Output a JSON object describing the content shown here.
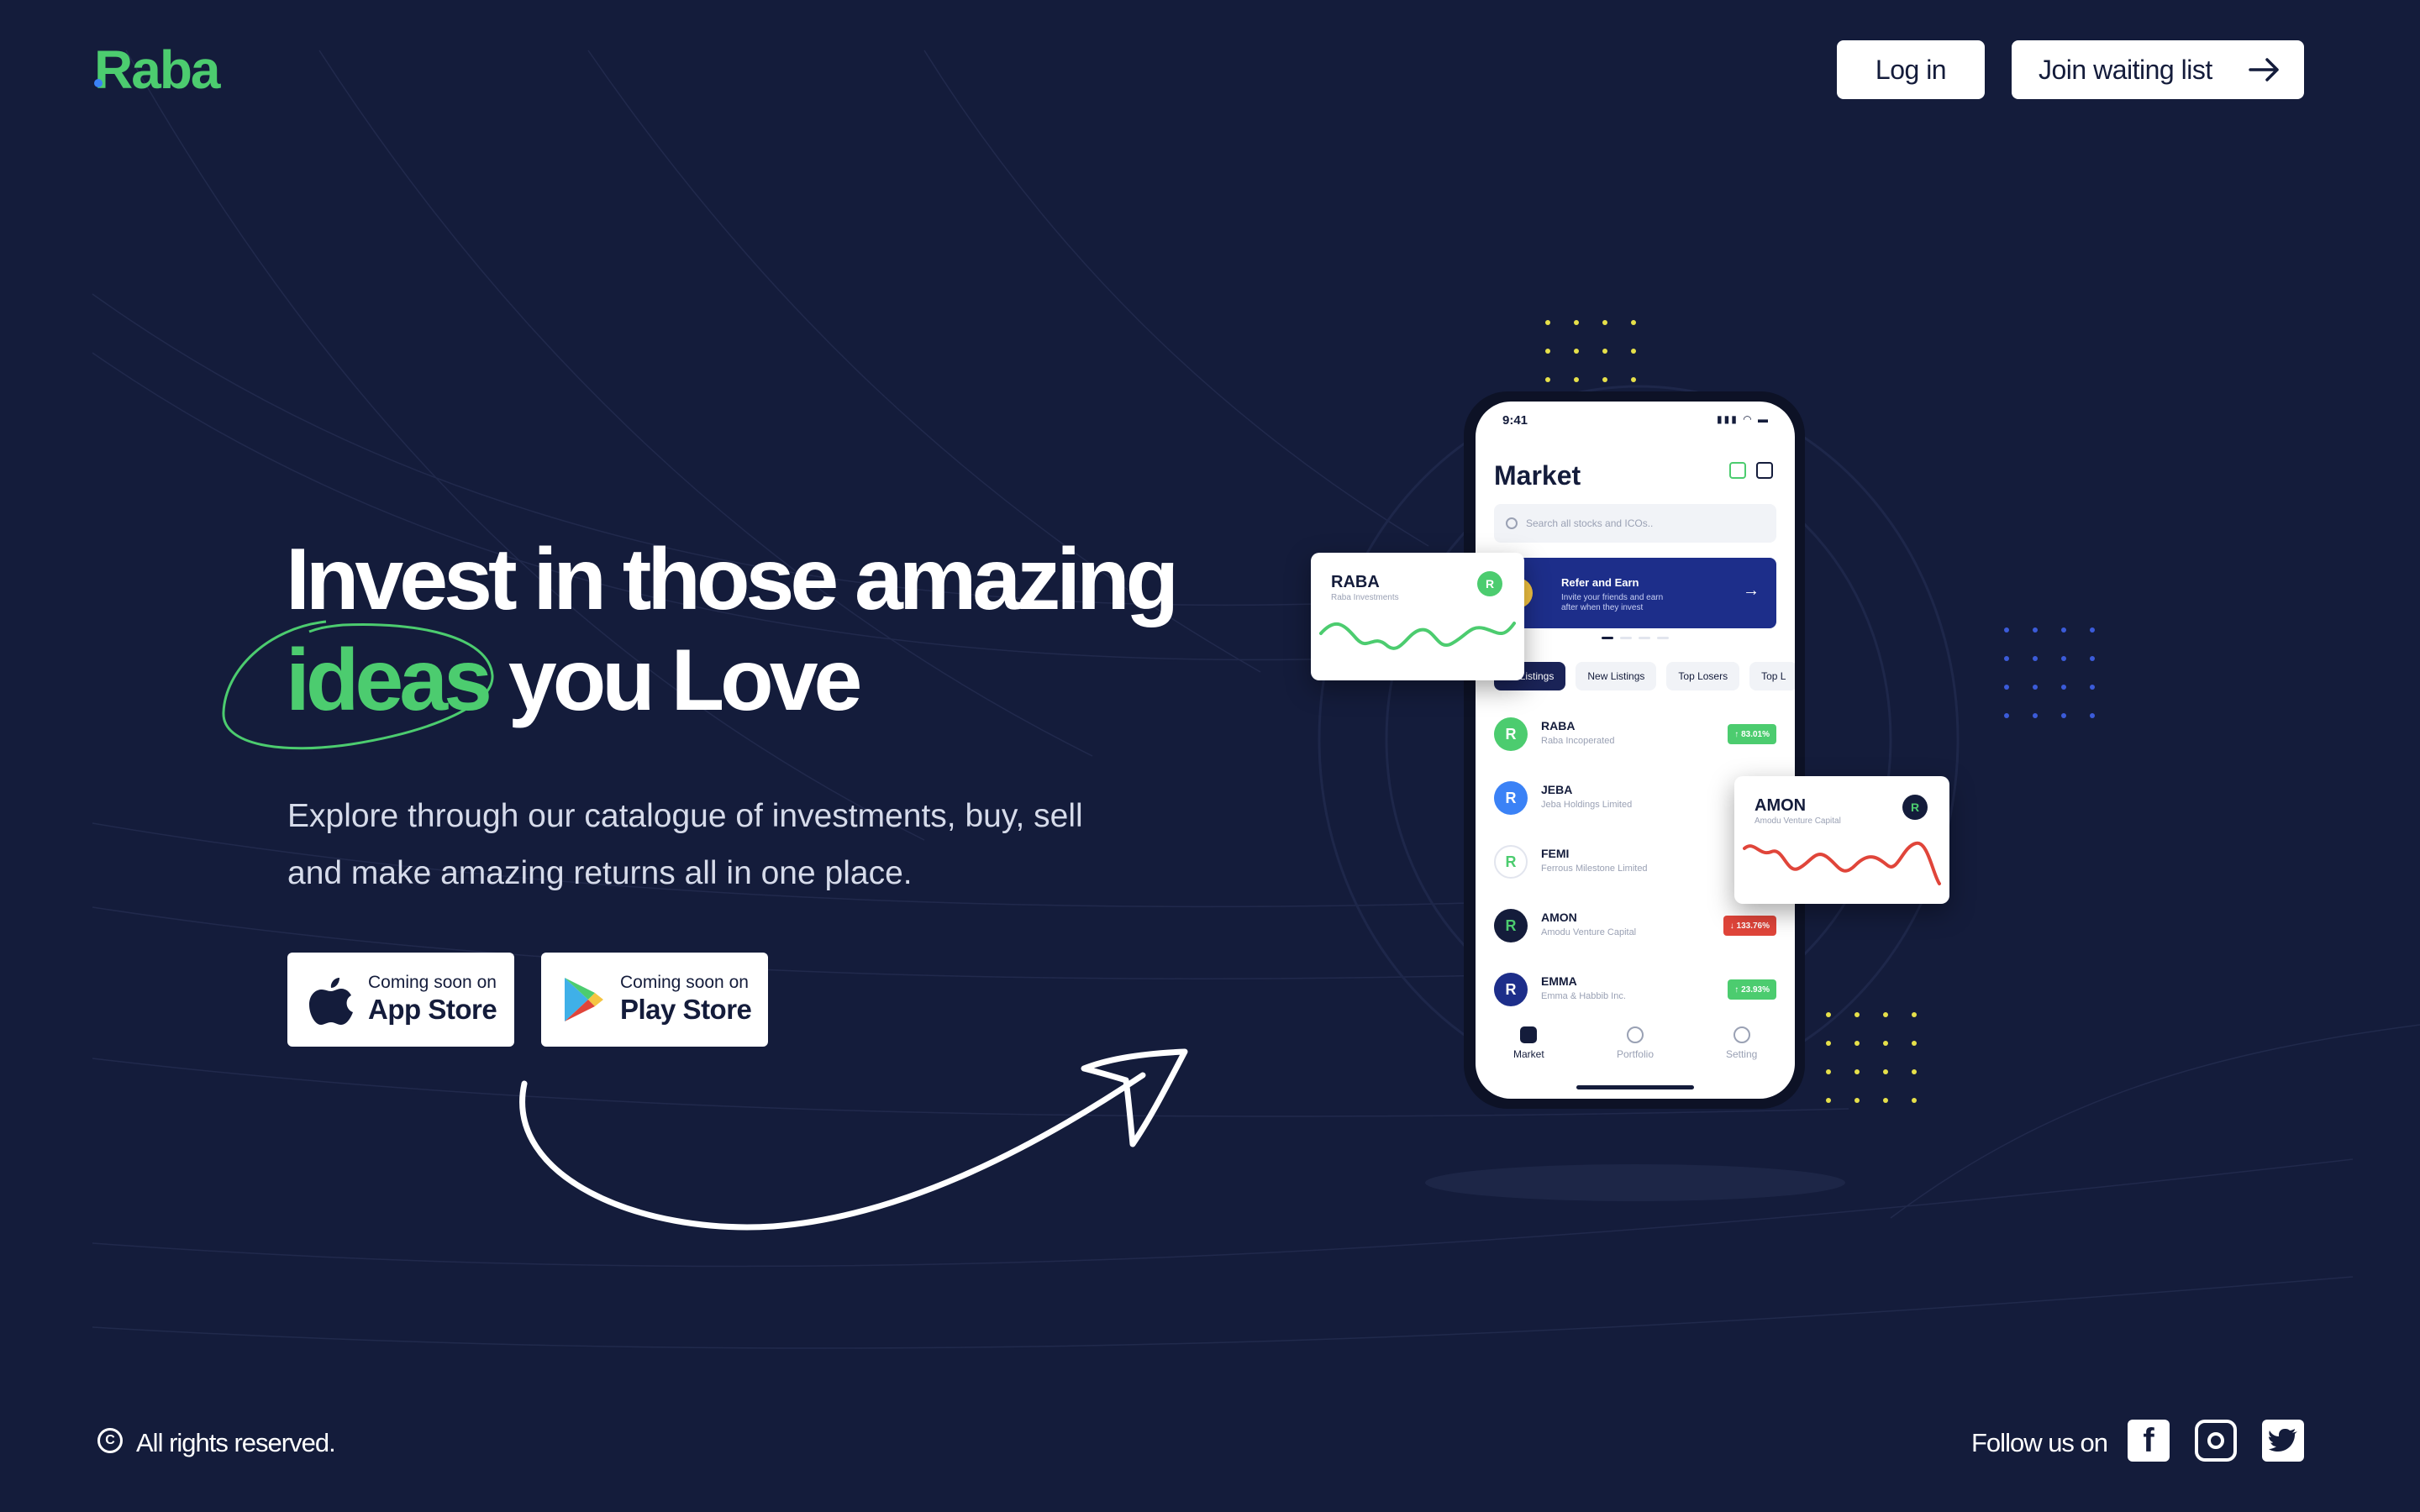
{
  "header": {
    "logo": "Raba",
    "login_label": "Log in",
    "waitlist_label": "Join waiting list"
  },
  "hero": {
    "headline_line1": "Invest in those amazing",
    "headline_highlight": "ideas",
    "headline_line2_rest": " you Love",
    "subtitle": "Explore through our catalogue of investments, buy, sell and make amazing returns all in one place.",
    "app_store": {
      "small": "Coming soon on",
      "big": "App Store"
    },
    "play_store": {
      "small": "Coming soon on",
      "big": "Play Store"
    }
  },
  "phone": {
    "time": "9:41",
    "title": "Market",
    "search_placeholder": "Search all stocks and ICOs..",
    "refer": {
      "title": "Refer and Earn",
      "desc": "Invite your friends and earn after when they invest"
    },
    "tabs": [
      "All Listings",
      "New Listings",
      "Top Losers",
      "Top L"
    ],
    "rows": [
      {
        "name": "RABA",
        "company": "Raba Incoperated",
        "change": "↑ 83.01%",
        "dir": "up",
        "color": "#4ccc6f"
      },
      {
        "name": "JEBA",
        "company": "Jeba Holdings Limited",
        "change": "↑",
        "dir": "up",
        "color": "#3b82f6"
      },
      {
        "name": "FEMI",
        "company": "Ferrous Milestone Limited",
        "change": "↓",
        "dir": "down",
        "color": "#ffffff"
      },
      {
        "name": "AMON",
        "company": "Amodu Venture Capital",
        "change": "↓ 133.76%",
        "dir": "down",
        "color": "#141c3b"
      },
      {
        "name": "EMMA",
        "company": "Emma & Habbib Inc.",
        "change": "↑ 23.93%",
        "dir": "up",
        "color": "#1d2e8a"
      }
    ],
    "nav": [
      "Market",
      "Portfolio",
      "Setting"
    ]
  },
  "cards": {
    "raba": {
      "name": "RABA",
      "sub": "Raba Investments"
    },
    "amon": {
      "name": "AMON",
      "sub": "Amodu Venture Capital"
    }
  },
  "footer": {
    "copyright": "All rights reserved.",
    "follow": "Follow us on"
  },
  "colors": {
    "background": "#141c3b",
    "brand_green": "#4ccc6f",
    "loss_red": "#e0453a"
  },
  "icons": [
    "arrow-right-icon",
    "apple-icon",
    "google-play-icon",
    "copyright-icon",
    "facebook-icon",
    "instagram-icon",
    "twitter-icon"
  ]
}
